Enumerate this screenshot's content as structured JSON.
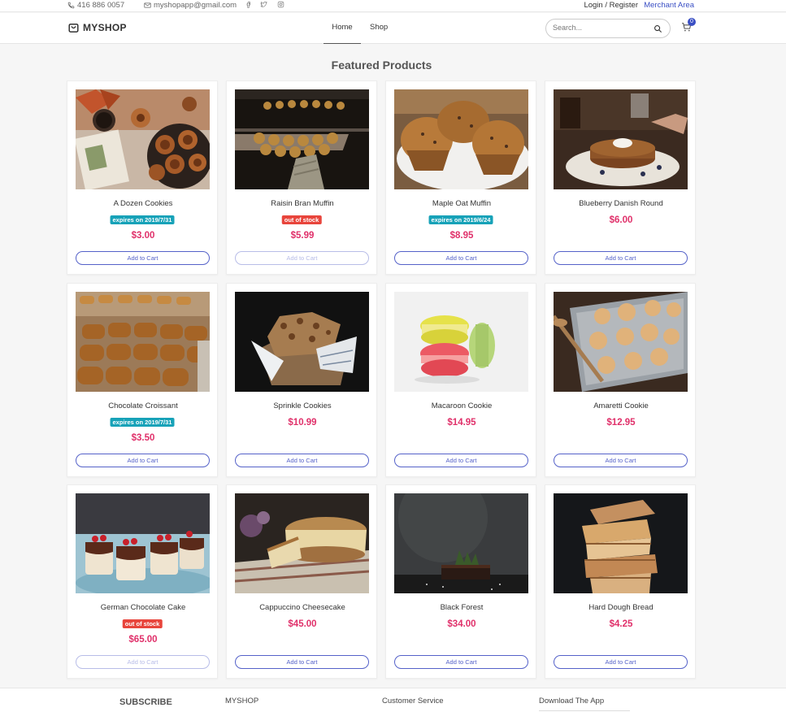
{
  "topbar": {
    "phone": "416 886 0057",
    "email": "myshopapp@gmail.com",
    "login": "Login / Register",
    "merchant": "Merchant Area"
  },
  "nav": {
    "brand": "MYSHOP",
    "home": "Home",
    "shop": "Shop",
    "search_placeholder": "Search...",
    "cart_count": "0"
  },
  "section_title": "Featured Products",
  "products": [
    {
      "name": "A Dozen Cookies",
      "badge": "expires on 2019/7/31",
      "badge_type": "teal",
      "price": "$3.00",
      "cart": "Add to Cart",
      "disabled": false
    },
    {
      "name": "Raisin Bran Muffin",
      "badge": "out of stock",
      "badge_type": "red",
      "price": "$5.99",
      "cart": "Add to Cart",
      "disabled": true
    },
    {
      "name": "Maple Oat Muffin",
      "badge": "expires on 2019/6/24",
      "badge_type": "teal",
      "price": "$8.95",
      "cart": "Add to Cart",
      "disabled": false
    },
    {
      "name": "Blueberry Danish Round",
      "badge": "",
      "badge_type": "",
      "price": "$6.00",
      "cart": "Add to Cart",
      "disabled": false
    },
    {
      "name": "Chocolate Croissant",
      "badge": "expires on 2019/7/31",
      "badge_type": "teal",
      "price": "$3.50",
      "cart": "Add to Cart",
      "disabled": false
    },
    {
      "name": "Sprinkle Cookies",
      "badge": "",
      "badge_type": "",
      "price": "$10.99",
      "cart": "Add to Cart",
      "disabled": false
    },
    {
      "name": "Macaroon Cookie",
      "badge": "",
      "badge_type": "",
      "price": "$14.95",
      "cart": "Add to Cart",
      "disabled": false
    },
    {
      "name": "Amaretti Cookie",
      "badge": "",
      "badge_type": "",
      "price": "$12.95",
      "cart": "Add to Cart",
      "disabled": false
    },
    {
      "name": "German Chocolate Cake",
      "badge": "out of stock",
      "badge_type": "red",
      "price": "$65.00",
      "cart": "Add to Cart",
      "disabled": true
    },
    {
      "name": "Cappuccino Cheesecake",
      "badge": "",
      "badge_type": "",
      "price": "$45.00",
      "cart": "Add to Cart",
      "disabled": false
    },
    {
      "name": "Black Forest",
      "badge": "",
      "badge_type": "",
      "price": "$34.00",
      "cart": "Add to Cart",
      "disabled": false
    },
    {
      "name": "Hard Dough Bread",
      "badge": "",
      "badge_type": "",
      "price": "$4.25",
      "cart": "Add to Cart",
      "disabled": false
    }
  ],
  "footer": {
    "subscribe": "SUBSCRIBE",
    "myshop": "MYSHOP",
    "customer_service": "Customer Service",
    "download": "Download The App"
  },
  "colors": {
    "accent": "#3a4fc4",
    "price": "#e0306a",
    "badge_teal": "#17a2b8",
    "badge_red": "#e8453c"
  }
}
